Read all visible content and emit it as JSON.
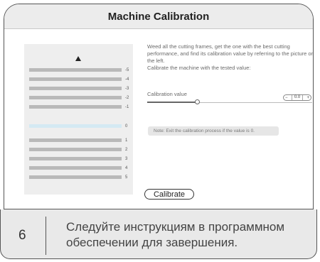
{
  "dialog": {
    "title": "Machine Calibration",
    "instructions": "Weed all the cutting frames, get the one with the best cutting performance, and find its calibration value by referring to the picture on the left.",
    "instructions_2": "Calibrate the machine with the tested value:",
    "calibration_label": "Calibration value",
    "calibration_value": "0.0",
    "stepper_minus": "−",
    "stepper_plus": "+",
    "slider_level_percent": 30,
    "note": "Note: Exit the calibration process if the value is 0.",
    "calibrate_button": "Calibrate"
  },
  "reference_bars": [
    "-5",
    "-4",
    "-3",
    "-2",
    "-1",
    "0",
    "1",
    "2",
    "3",
    "4",
    "5"
  ],
  "step": {
    "number": "6",
    "text": "Следуйте инструкциям в программном обеспечении для завершения."
  }
}
